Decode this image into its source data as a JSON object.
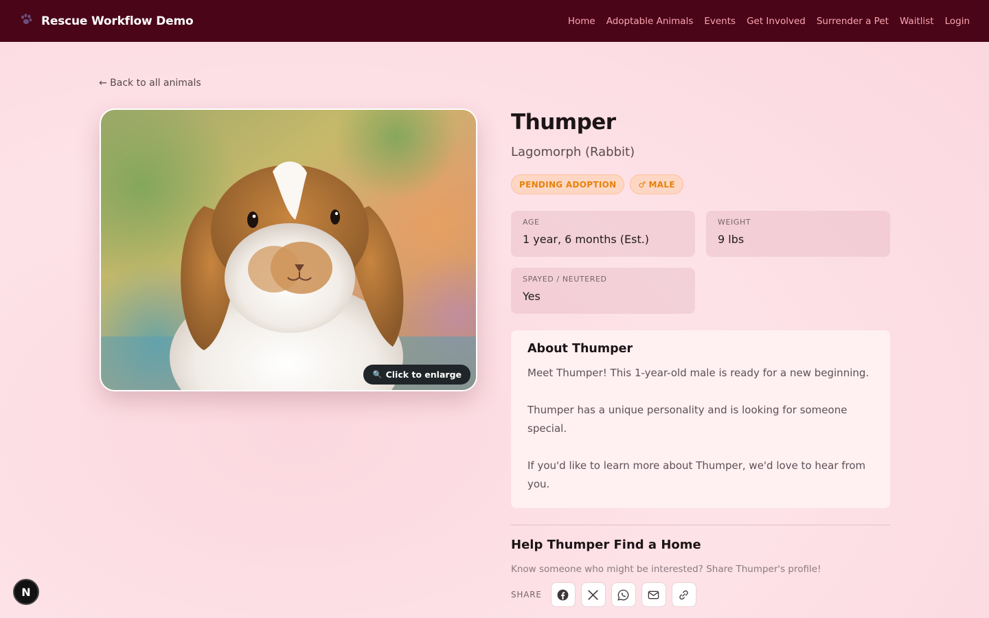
{
  "nav": {
    "brand_icon": "paw-icon",
    "brand_title": "Rescue Workflow Demo",
    "links": [
      "Home",
      "Adoptable Animals",
      "Events",
      "Get Involved",
      "Surrender a Pet",
      "Waitlist",
      "Login"
    ]
  },
  "back_link": "← Back to all animals",
  "photo": {
    "enlarge_label": "Click to enlarge",
    "enlarge_icon": "magnifier-icon"
  },
  "animal": {
    "name": "Thumper",
    "species": "Lagomorph (Rabbit)",
    "status_badge": "PENDING ADOPTION",
    "gender_symbol": "♂",
    "gender_badge": "MALE",
    "stats": {
      "age_label": "AGE",
      "age_value": "1 year, 6 months (Est.)",
      "weight_label": "WEIGHT",
      "weight_value": "9 lbs",
      "spayed_label": "SPAYED / NEUTERED",
      "spayed_value": "Yes"
    }
  },
  "about": {
    "title": "About Thumper",
    "paragraphs": [
      "Meet Thumper! This 1-year-old male is ready for a new beginning.",
      "Thumper has a unique personality and is looking for someone special.",
      "If you'd like to learn more about Thumper, we'd love to hear from you."
    ]
  },
  "help": {
    "title": "Help Thumper Find a Home",
    "subtitle": "Know someone who might be interested? Share Thumper's profile!",
    "share_label": "SHARE",
    "share_icons": [
      "facebook-icon",
      "x-icon",
      "whatsapp-icon",
      "email-icon",
      "link-icon"
    ]
  },
  "dev_badge": "N",
  "colors": {
    "navbar": "#4a0519",
    "nav_link": "#fda4af",
    "badge_text": "#e5820b",
    "badge_bg": "#fed7c4",
    "page_bg": "#fde3e8"
  }
}
